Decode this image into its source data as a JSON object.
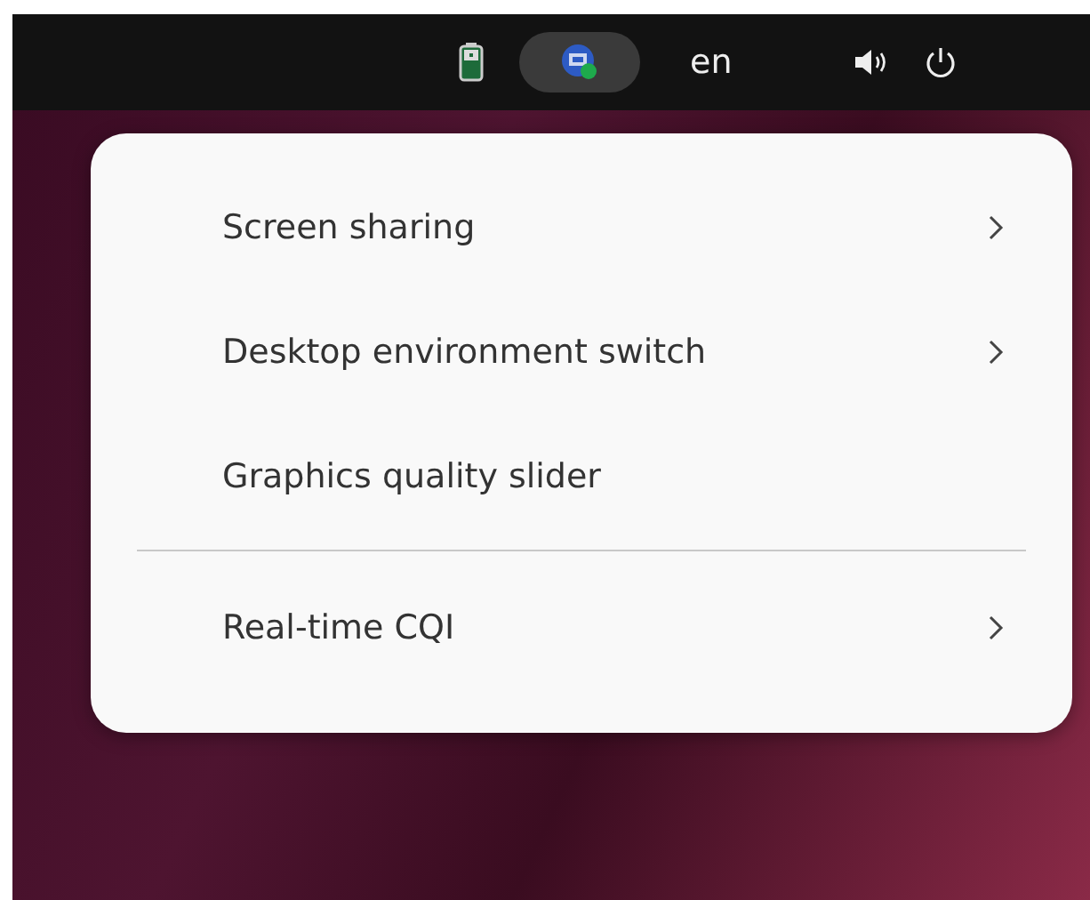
{
  "top_bar": {
    "indicators": [
      {
        "kind": "battery",
        "selected": false
      },
      {
        "kind": "app",
        "selected": true
      },
      {
        "kind": "text",
        "label": "en",
        "selected": false
      },
      {
        "kind": "volume",
        "selected": false
      },
      {
        "kind": "power",
        "selected": false
      }
    ]
  },
  "menu": {
    "items": [
      {
        "kind": "item",
        "label": "Screen sharing",
        "submenu": true
      },
      {
        "kind": "item",
        "label": "Desktop environment switch",
        "submenu": true
      },
      {
        "kind": "item",
        "label": "Graphics quality slider",
        "submenu": false
      },
      {
        "kind": "separator"
      },
      {
        "kind": "item",
        "label": "Real-time CQI",
        "submenu": true
      }
    ]
  }
}
